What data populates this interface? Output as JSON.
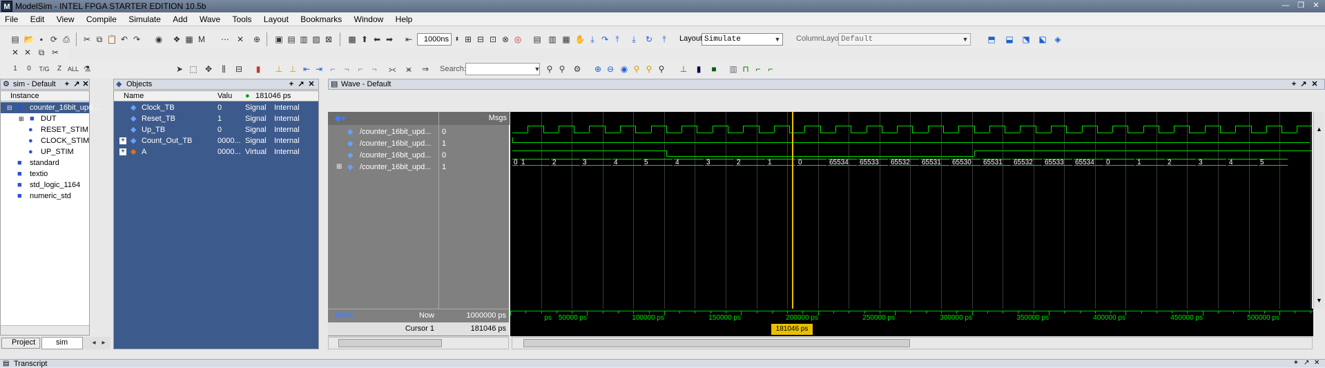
{
  "window": {
    "title": "ModelSim - INTEL FPGA STARTER EDITION 10.5b",
    "app_icon": "M"
  },
  "menu": [
    "File",
    "Edit",
    "View",
    "Compile",
    "Simulate",
    "Add",
    "Wave",
    "Tools",
    "Layout",
    "Bookmarks",
    "Window",
    "Help"
  ],
  "toolbar": {
    "run_length": "1000ns",
    "layout_label": "Layout",
    "layout_value": "Simulate",
    "column_layout_label": "ColumnLayout",
    "column_layout_value": "Default",
    "search_label": "Search:",
    "search_placeholder": ""
  },
  "instance_pane": {
    "title": "sim - Default",
    "column": "Instance",
    "items": [
      {
        "label": "counter_16bit_upd...",
        "level": 0,
        "expand": "-"
      },
      {
        "label": "DUT",
        "level": 1,
        "expand": "+"
      },
      {
        "label": "RESET_STIM",
        "level": 1,
        "expand": ""
      },
      {
        "label": "CLOCK_STIM",
        "level": 1,
        "expand": ""
      },
      {
        "label": "UP_STIM",
        "level": 1,
        "expand": ""
      },
      {
        "label": "standard",
        "level": 0,
        "expand": ""
      },
      {
        "label": "textio",
        "level": 0,
        "expand": ""
      },
      {
        "label": "std_logic_1164",
        "level": 0,
        "expand": ""
      },
      {
        "label": "numeric_std",
        "level": 0,
        "expand": ""
      }
    ],
    "tabs": [
      "Project",
      "sim"
    ]
  },
  "objects_pane": {
    "title": "Objects",
    "columns": {
      "name": "Name",
      "value": "Valu",
      "time": "181046 ps"
    },
    "rows": [
      {
        "name": "Clock_TB",
        "value": "0",
        "kind": "Signal",
        "mode": "Internal",
        "expand": ""
      },
      {
        "name": "Reset_TB",
        "value": "1",
        "kind": "Signal",
        "mode": "Internal",
        "expand": ""
      },
      {
        "name": "Up_TB",
        "value": "0",
        "kind": "Signal",
        "mode": "Internal",
        "expand": ""
      },
      {
        "name": "Count_Out_TB",
        "value": "0000...",
        "kind": "Signal",
        "mode": "Internal",
        "expand": "+"
      },
      {
        "name": "A",
        "value": "0000...",
        "kind": "Virtual",
        "mode": "Internal",
        "expand": "+"
      }
    ]
  },
  "wave_pane": {
    "title": "Wave - Default",
    "msgs_header": "Msgs",
    "signals": [
      {
        "name": "/counter_16bit_upd...",
        "msg": "0"
      },
      {
        "name": "/counter_16bit_upd...",
        "msg": "1"
      },
      {
        "name": "/counter_16bit_upd...",
        "msg": "0"
      },
      {
        "name": "/counter_16bit_upd...",
        "msg": "1"
      }
    ],
    "count_values": [
      "0",
      "1",
      "2",
      "3",
      "4",
      "5",
      "4",
      "3",
      "2",
      "1",
      "0",
      "65534",
      "65533",
      "65532",
      "65531",
      "65530",
      "65531",
      "65532",
      "65533",
      "65534",
      "0",
      "1",
      "2",
      "3",
      "4",
      "5"
    ],
    "now_label": "Now",
    "now_value": "1000000 ps",
    "cursor_label": "Cursor 1",
    "cursor_value": "181046 ps",
    "cursor_marker": "181046 ps",
    "time_ticks": [
      "ps",
      "50000 ps",
      "100000 ps",
      "150000 ps",
      "200000 ps",
      "250000 ps",
      "300000 ps",
      "350000 ps",
      "400000 ps",
      "450000 ps",
      "500000 ps"
    ]
  },
  "transcript": {
    "title": "Transcript"
  },
  "colors": {
    "wave_bg": "#000000",
    "signal": "#00e000",
    "cursor": "#e8c000",
    "selection": "#3d5a8c"
  }
}
